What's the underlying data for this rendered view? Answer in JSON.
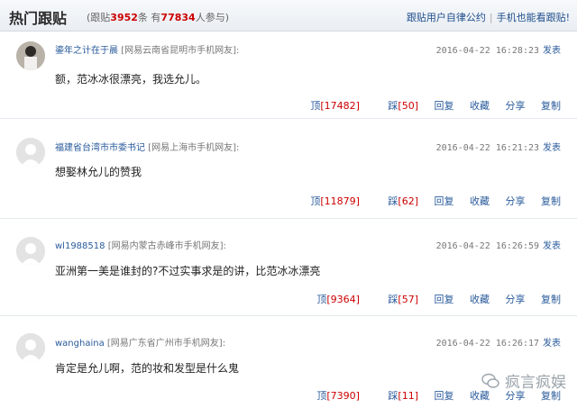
{
  "header": {
    "title": "热门跟贴",
    "stats_prefix": "(跟贴",
    "stats_count": "3952",
    "stats_mid": "条 有",
    "stats_people": "77834",
    "stats_suffix": "人参与)",
    "link_rules": "跟贴用户自律公约",
    "link_mobile": "手机也能看跟贴!"
  },
  "comments": [
    {
      "user": "鎏年之计在于晨",
      "location": "[网易云南省昆明市手机网友]:",
      "time": "2016-04-22 16:28:23",
      "post": "发表",
      "text": "额，范冰冰很漂亮，我选允儿。",
      "up": "[17482]",
      "down": "[50]"
    },
    {
      "user": "福建省台湾市市委书记",
      "location": "[网易上海市手机网友]:",
      "time": "2016-04-22 16:21:23",
      "post": "发表",
      "text": "想娶林允儿的赞我",
      "up": "[11879]",
      "down": "[62]"
    },
    {
      "user": "wl1988518",
      "location": "[网易内蒙古赤峰市手机网友]:",
      "time": "2016-04-22 16:26:59",
      "post": "发表",
      "text": "亚洲第一美是谁封的?不过实事求是的讲，比范冰冰漂亮",
      "up": "[9364]",
      "down": "[57]"
    },
    {
      "user": "wanghaina",
      "location": "[网易广东省广州市手机网友]:",
      "time": "2016-04-22 16:26:17",
      "post": "发表",
      "text": "肯定是允儿啊，范的妆和发型是什么鬼",
      "up": "[7390]",
      "down": "[11]"
    }
  ],
  "actions": {
    "up": "顶",
    "down": "踩",
    "reply": "回复",
    "collect": "收藏",
    "share": "分享",
    "copy": "复制"
  },
  "watermark": "疯言疯娱"
}
